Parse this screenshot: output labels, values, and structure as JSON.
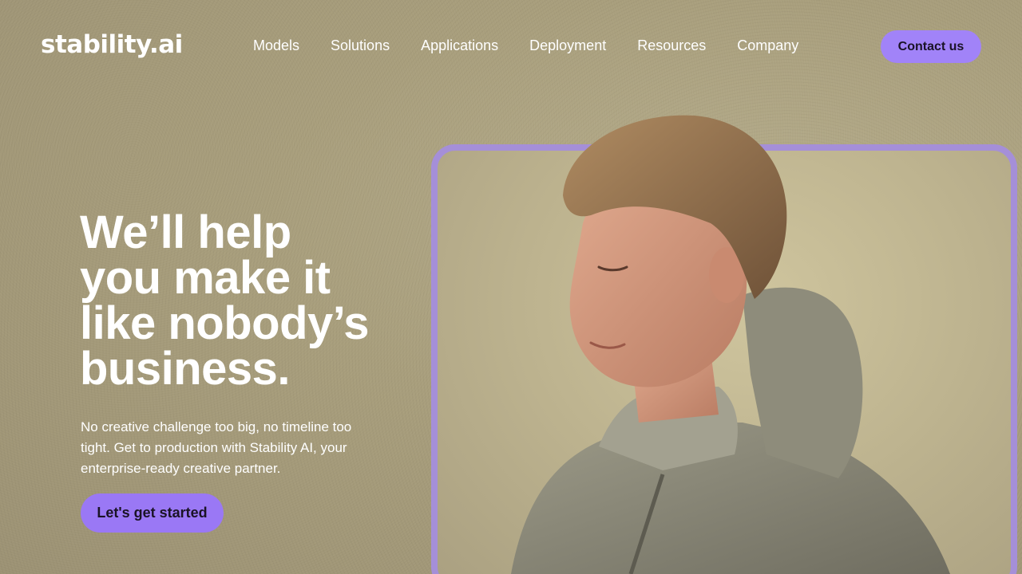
{
  "header": {
    "logo": "stability.ai",
    "nav": [
      "Models",
      "Solutions",
      "Applications",
      "Deployment",
      "Resources",
      "Company"
    ],
    "contact_label": "Contact us"
  },
  "hero": {
    "title_lines": [
      "We’ll help",
      "you make it",
      "like nobody’s",
      "business."
    ],
    "subtitle": "No creative challenge too big, no timeline too tight. Get to production with Stability AI, your enterprise-ready creative partner.",
    "cta_label": "Let's get started"
  },
  "colors": {
    "accent": "#a183f8",
    "cta": "#9a78f5",
    "background": "#a89e7c",
    "frame": "#a58fd8"
  }
}
